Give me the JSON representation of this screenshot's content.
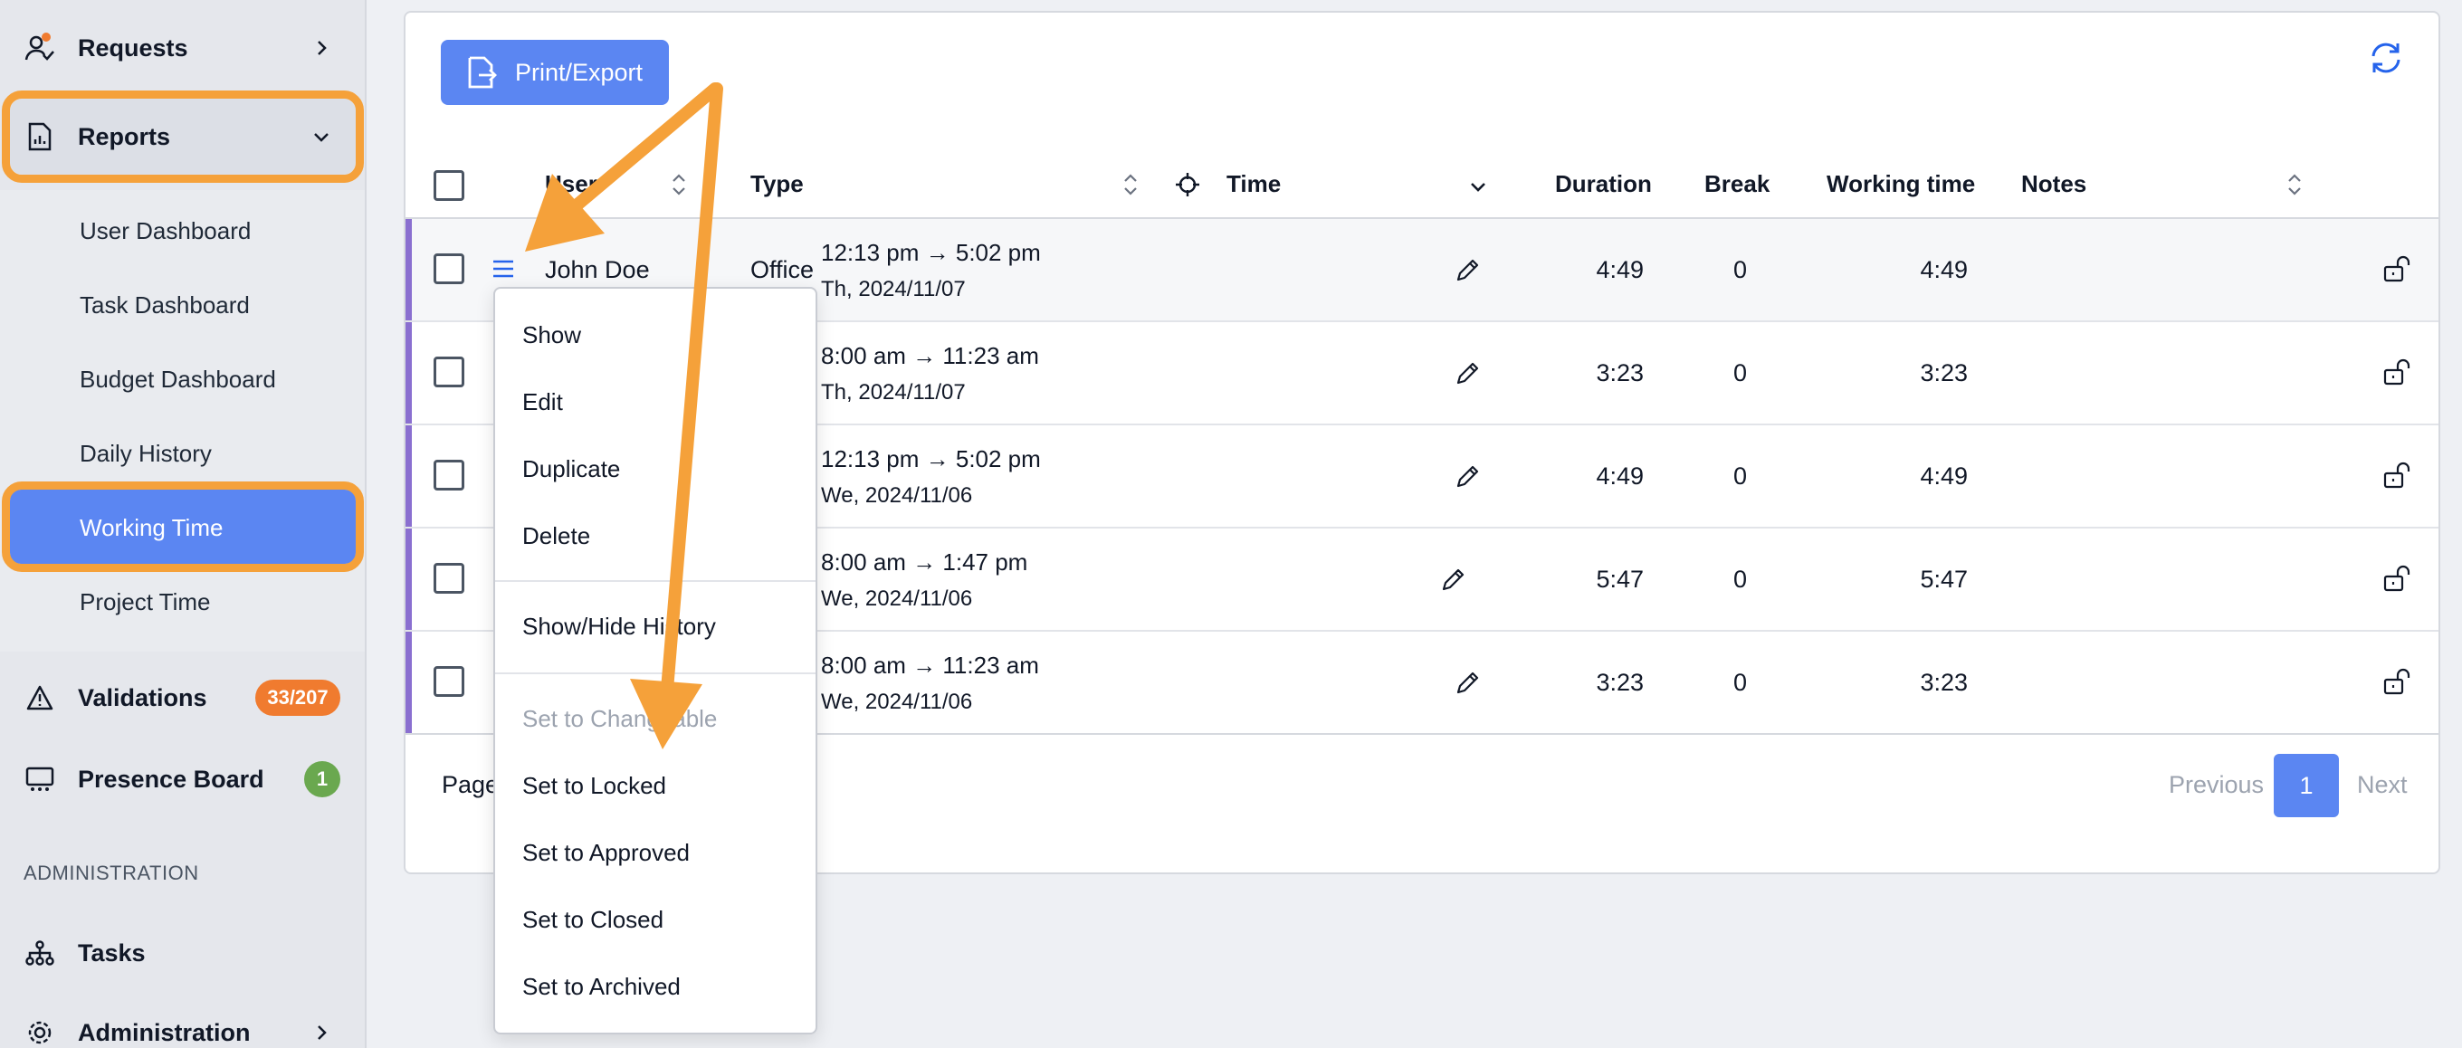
{
  "sidebar": {
    "requests_label": "Requests",
    "reports_label": "Reports",
    "sub_items": [
      "User Dashboard",
      "Task Dashboard",
      "Budget Dashboard",
      "Daily History",
      "Working Time",
      "Project Time"
    ],
    "validations_label": "Validations",
    "validations_badge": "33/207",
    "presence_label": "Presence Board",
    "presence_badge": "1",
    "section_admin": "ADMINISTRATION",
    "tasks_label": "Tasks",
    "administration_label": "Administration"
  },
  "toolbar": {
    "export_label": "Print/Export"
  },
  "table": {
    "headers": {
      "user": "User",
      "type": "Type",
      "time": "Time",
      "duration": "Duration",
      "break": "Break",
      "working_time": "Working time",
      "notes": "Notes"
    },
    "rows": [
      {
        "user": "John Doe",
        "type": "Office",
        "time_range": "12:13 pm → 5:02 pm",
        "date": "Th, 2024/11/07",
        "duration": "4:49",
        "break": "0",
        "working_time": "4:49"
      },
      {
        "user": "",
        "type": "",
        "time_range": "8:00 am → 11:23 am",
        "date": "Th, 2024/11/07",
        "duration": "3:23",
        "break": "0",
        "working_time": "3:23"
      },
      {
        "user": "",
        "type": "",
        "time_range": "12:13 pm → 5:02 pm",
        "date": "We, 2024/11/06",
        "duration": "4:49",
        "break": "0",
        "working_time": "4:49"
      },
      {
        "user": "",
        "type": "",
        "time_range": "8:00 am → 1:47 pm",
        "date": "We, 2024/11/06",
        "duration": "5:47",
        "break": "0",
        "working_time": "5:47"
      },
      {
        "user": "",
        "type": "",
        "time_range": "8:00 am → 11:23 am",
        "date": "We, 2024/11/06",
        "duration": "3:23",
        "break": "0",
        "working_time": "3:23"
      }
    ]
  },
  "pagination": {
    "label": "Page",
    "previous": "Previous",
    "current": "1",
    "next": "Next"
  },
  "context_menu": {
    "items": [
      "Show",
      "Edit",
      "Duplicate",
      "Delete",
      "Show/Hide History",
      "Set to Changeable",
      "Set to Locked",
      "Set to Approved",
      "Set to Closed",
      "Set to Archived"
    ]
  },
  "colors": {
    "accent": "#5b86f2",
    "highlight": "#f5a13a",
    "badge_orange": "#f07b2f",
    "badge_green": "#6aa84f",
    "row_accent": "#8a6fd0"
  }
}
